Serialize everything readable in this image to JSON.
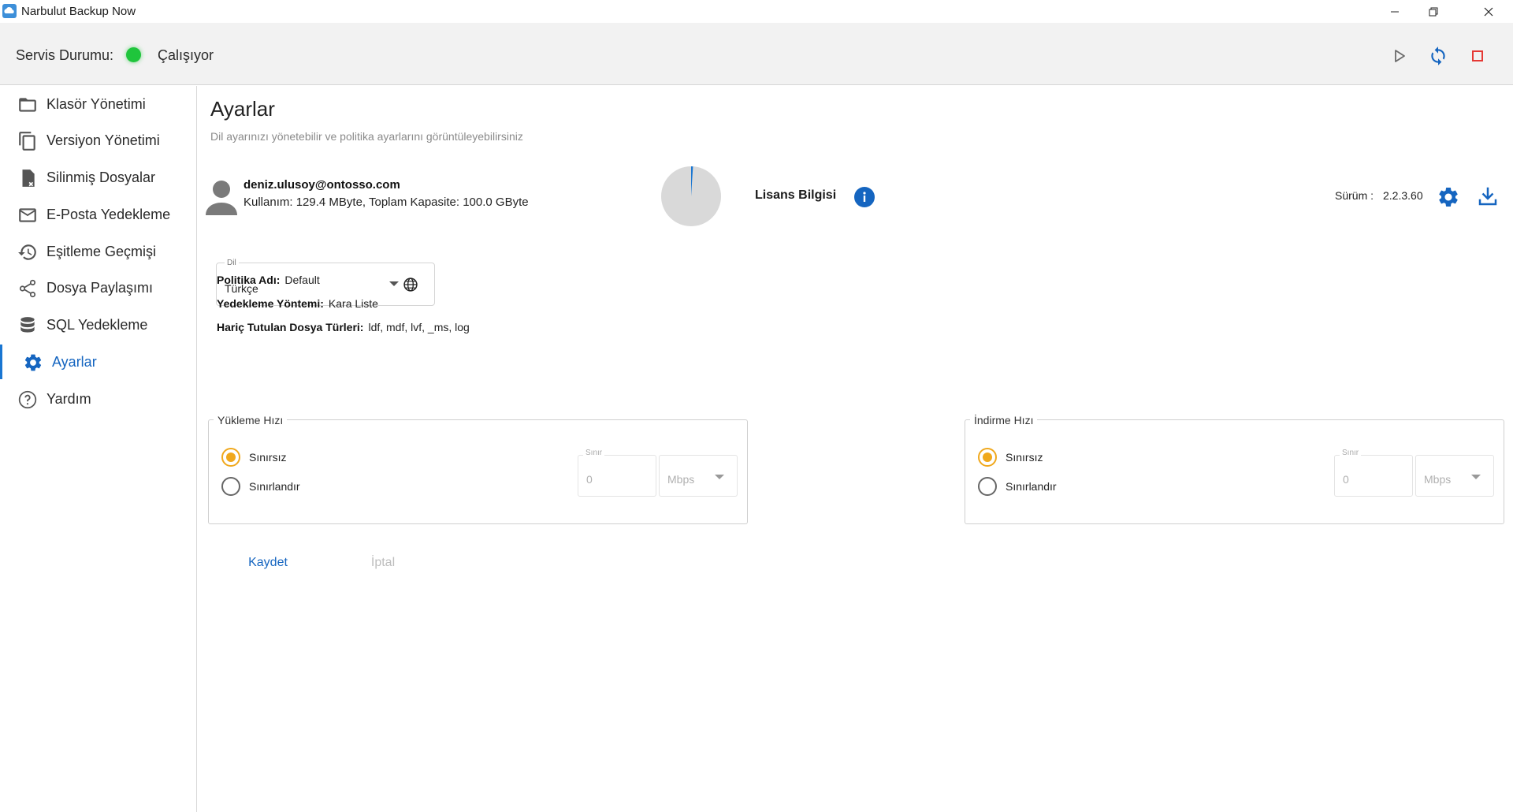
{
  "window": {
    "title": "Narbulut Backup Now",
    "controls": [
      "minimize-icon",
      "restore-icon",
      "close-icon"
    ]
  },
  "status": {
    "label": "Servis Durumu:",
    "value": "Çalışıyor",
    "indicator_color": "#1fc53c",
    "actions": [
      "play-icon",
      "sync-icon",
      "stop-icon"
    ]
  },
  "sidebar": {
    "items": [
      {
        "label": "Klasör Yönetimi",
        "icon": "folder-icon"
      },
      {
        "label": "Versiyon Yönetimi",
        "icon": "copy-icon"
      },
      {
        "label": "Silinmiş Dosyalar",
        "icon": "deleted-file-icon"
      },
      {
        "label": "E-Posta Yedekleme",
        "icon": "mail-icon"
      },
      {
        "label": "Eşitleme Geçmişi",
        "icon": "history-icon"
      },
      {
        "label": "Dosya Paylaşımı",
        "icon": "share-icon"
      },
      {
        "label": "SQL Yedekleme",
        "icon": "database-icon"
      },
      {
        "label": "Ayarlar",
        "icon": "gear-icon",
        "active": true
      },
      {
        "label": "Yardım",
        "icon": "help-icon"
      }
    ]
  },
  "page": {
    "title": "Ayarlar",
    "subtitle": "Dil ayarınızı yönetebilir ve politika ayarlarını görüntüleyebilirsiniz"
  },
  "account": {
    "email": "deniz.ulusoy@ontosso.com",
    "usage": "Kullanım: 129.4 MByte, Toplam Kapasite: 100.0 GByte",
    "usage_fraction": 0.0013
  },
  "license": {
    "label": "Lisans Bilgisi",
    "version_label": "Sürüm :",
    "version_value": "2.2.3.60"
  },
  "language": {
    "legend": "Dil",
    "value": "Türkçe"
  },
  "policy": {
    "name_key": "Politika Adı:",
    "name_value": "Default",
    "method_key": "Yedekleme Yöntemi:",
    "method_value": "Kara Liste",
    "excluded_key": "Hariç Tutulan Dosya Türleri:",
    "excluded_value": "ldf, mdf, lvf, _ms, log"
  },
  "upload": {
    "legend": "Yükleme Hızı",
    "option_unlimited": "Sınırsız",
    "option_limited": "Sınırlandır",
    "selected": "unlimited",
    "limit_legend": "Sınır",
    "limit_value": "0",
    "unit": "Mbps"
  },
  "download": {
    "legend": "İndirme Hızı",
    "option_unlimited": "Sınırsız",
    "option_limited": "Sınırlandır",
    "selected": "unlimited",
    "limit_legend": "Sınır",
    "limit_value": "0",
    "unit": "Mbps"
  },
  "actions": {
    "save": "Kaydet",
    "cancel": "İptal"
  },
  "colors": {
    "accent": "#1565c0",
    "radio_selected": "#f0a81c",
    "stop": "#e53935"
  }
}
